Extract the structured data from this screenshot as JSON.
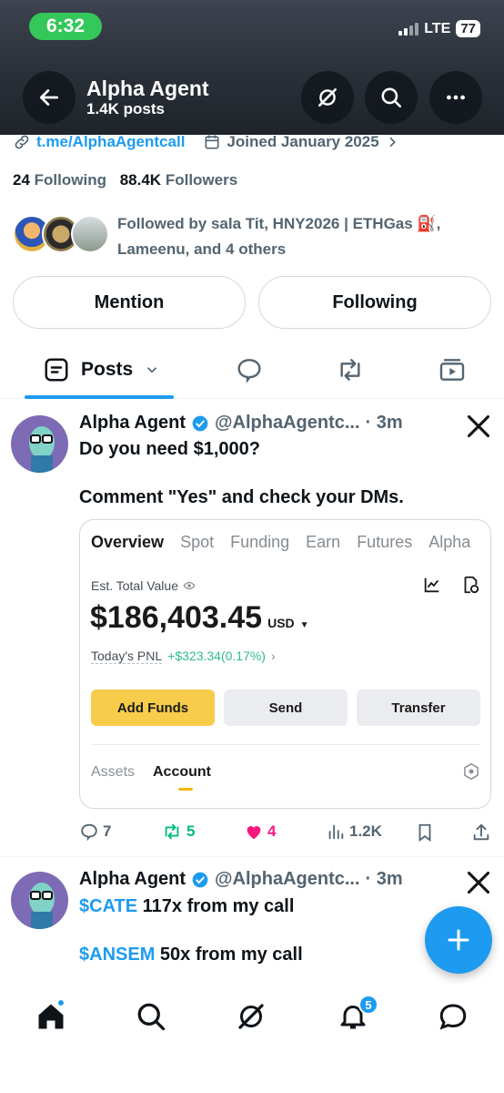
{
  "status_bar": {
    "time": "6:32",
    "network": "LTE",
    "battery": "77"
  },
  "header": {
    "title": "Alpha Agent",
    "subtitle": "1.4K posts"
  },
  "profile": {
    "link": "t.me/AlphaAgentcall",
    "joined": "Joined January 2025",
    "following_count": "24",
    "following_label": "Following",
    "followers_count": "88.4K",
    "followers_label": "Followers",
    "followed_by_line1": "Followed by sala Tit, HNY2026 | ETHGas ⛽,",
    "followed_by_line2": "Lameenu, and 4 others"
  },
  "buttons": {
    "mention": "Mention",
    "following": "Following"
  },
  "tabs": {
    "posts": "Posts"
  },
  "post1": {
    "name": "Alpha Agent",
    "handle": "@AlphaAgentc...",
    "time": "· 3m",
    "line1": "Do you need $1,000?",
    "line2": "Comment \"Yes\" and check your DMs.",
    "card": {
      "tabs": [
        "Overview",
        "Spot",
        "Funding",
        "Earn",
        "Futures",
        "Alpha"
      ],
      "est_label": "Est. Total Value",
      "total": "$186,403.45",
      "currency": "USD",
      "pnl_label": "Today's PNL",
      "pnl_value": "+$323.34(0.17%)",
      "add_funds": "Add Funds",
      "send": "Send",
      "transfer": "Transfer",
      "assets": "Assets",
      "account": "Account"
    },
    "replies": "7",
    "reposts": "5",
    "likes": "4",
    "views": "1.2K"
  },
  "post2": {
    "name": "Alpha Agent",
    "handle": "@AlphaAgentc...",
    "time": "· 3m",
    "cashtag1": "$CATE",
    "text1": " 117x from my call",
    "cashtag2": "$ANSEM",
    "text2": " 50x from my call"
  },
  "nav": {
    "notifications_badge": "5"
  },
  "colors": {
    "accent": "#1d9bf0",
    "like": "#f91880",
    "repost": "#00ba7c",
    "binance_yellow": "#f6cc4a"
  }
}
